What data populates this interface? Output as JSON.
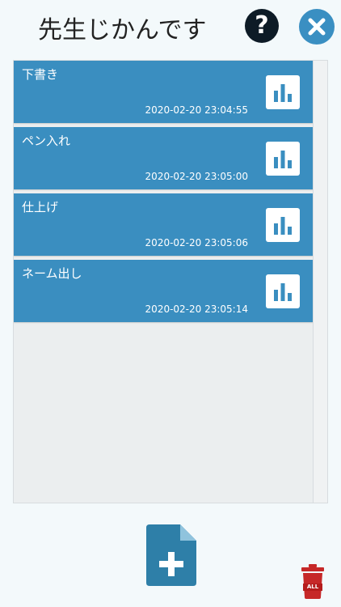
{
  "header": {
    "title": "先生じかんです",
    "help_label": "?"
  },
  "entries": [
    {
      "title": "下書き",
      "timestamp": "2020-02-20 23:04:55"
    },
    {
      "title": "ペン入れ",
      "timestamp": "2020-02-20 23:05:00"
    },
    {
      "title": "仕上げ",
      "timestamp": "2020-02-20 23:05:06"
    },
    {
      "title": "ネーム出し",
      "timestamp": "2020-02-20 23:05:14"
    }
  ],
  "footer": {
    "delete_all_label": "ALL"
  },
  "colors": {
    "accent": "#3a8ec0",
    "close_button": "#3a8fc2",
    "help_button": "#0d1b26",
    "new_doc": "#2e7fa8",
    "trash": "#c62828",
    "background": "#f3f9fb"
  },
  "icons": {
    "help": "question-circle-icon",
    "close": "close-circle-icon",
    "stats": "bar-chart-icon",
    "new": "file-add-icon",
    "trash": "trash-all-icon"
  }
}
